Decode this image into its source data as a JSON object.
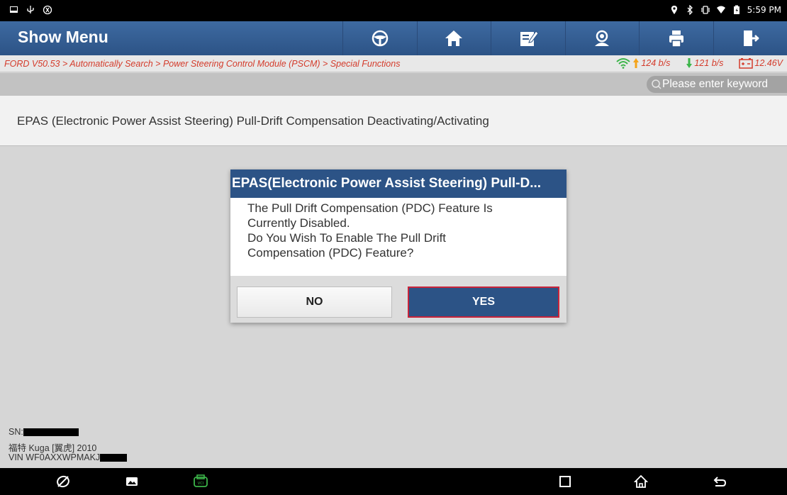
{
  "status_bar": {
    "time": "5:59 PM",
    "left_icons": [
      "gallery-icon",
      "usb-icon",
      "vci-icon"
    ],
    "right_icons": [
      "location-icon",
      "bluetooth-icon",
      "vibrate-icon",
      "wifi-icon",
      "battery-icon"
    ]
  },
  "header": {
    "title": "Show Menu",
    "tools": [
      "steering-wheel-icon",
      "home-icon",
      "edit-report-icon",
      "support-icon",
      "print-icon",
      "exit-icon"
    ]
  },
  "breadcrumb": {
    "path": "FORD V50.53 > Automatically Search > Power Steering Control Module (PSCM) > Special Functions",
    "upload_speed": "124 b/s",
    "download_speed": "121 b/s",
    "battery_voltage": "12.46V"
  },
  "search": {
    "placeholder": "Please enter keyword"
  },
  "list": {
    "items": [
      {
        "label": "EPAS (Electronic Power Assist Steering) Pull-Drift Compensation Deactivating/Activating"
      }
    ]
  },
  "dialog": {
    "title": "EPAS(Electronic Power Assist Steering) Pull-D...",
    "message_lines": [
      "The Pull Drift Compensation (PDC) Feature Is",
      "Currently Disabled.",
      "Do You Wish To Enable The Pull Drift",
      "Compensation (PDC) Feature?"
    ],
    "no_label": "NO",
    "yes_label": "YES"
  },
  "footer": {
    "sn_label": "SN:",
    "vehicle": "福特 Kuga [翼虎] 2010",
    "vin_prefix": "VIN WF0AXXWPMAKJ"
  },
  "colors": {
    "header_blue": "#2c5386",
    "breadcrumb_red": "#d43b2b",
    "yes_border": "#c8243a"
  }
}
